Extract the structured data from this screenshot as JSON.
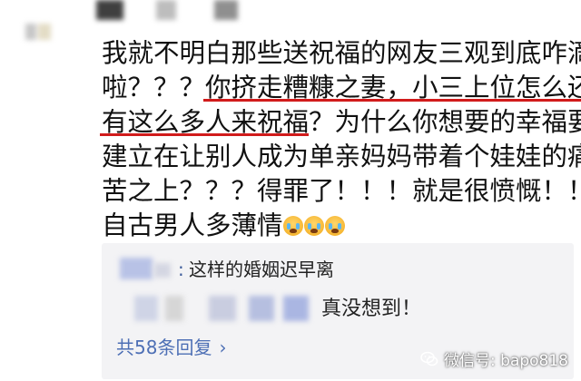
{
  "comment": {
    "lines": [
      {
        "parts": [
          {
            "text": "我就不明白那些送祝福的网友三观到底咋滴",
            "underline": false
          }
        ]
      },
      {
        "parts": [
          {
            "text": "啦？？？",
            "underline": false
          },
          {
            "text": "你挤走糟糠之妻，小三上位怎么还",
            "underline": true
          }
        ]
      },
      {
        "parts": [
          {
            "text": "有这么多人来祝福",
            "underline": true
          },
          {
            "text": "？为什么你想要的幸福要",
            "underline": false
          }
        ]
      },
      {
        "parts": [
          {
            "text": "建立在让别人成为单亲妈妈带着个娃娃的痛",
            "underline": false
          }
        ]
      },
      {
        "parts": [
          {
            "text": "苦之上？？？得罪了！！！就是很愤慨！！",
            "underline": false
          }
        ]
      },
      {
        "parts": [
          {
            "text": "自古男人多薄情",
            "underline": false
          }
        ],
        "emoji_count": 3
      }
    ],
    "emoji_icon": "crying-face-icon",
    "highlight_color": "#d11b1b"
  },
  "replies": [
    {
      "colon": ":",
      "text": "这样的婚姻迟早离"
    },
    {
      "text": "真没想到！"
    }
  ],
  "more_replies": {
    "label": "共58条回复",
    "chevron": "›"
  },
  "watermark": {
    "icon": "wechat-icon",
    "text": "微信号: bapo818"
  },
  "colors": {
    "link": "#4d6fb5",
    "reply_bg": "#f3f3f5",
    "text": "#111111"
  }
}
